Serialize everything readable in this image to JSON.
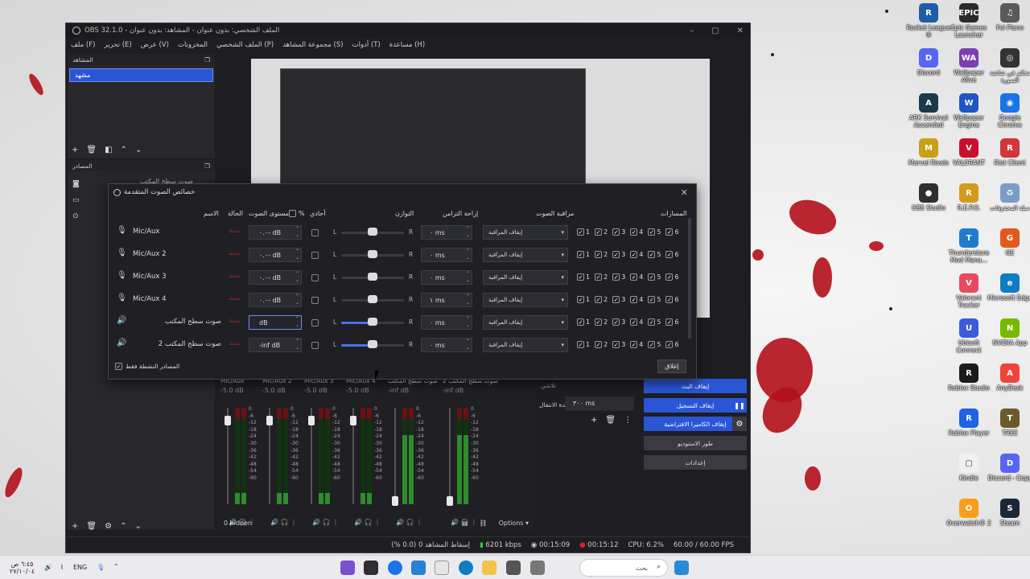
{
  "desktop": {
    "icons": [
      {
        "label": "Rocket League ®",
        "color": "#1e5ea8",
        "glyph": "R"
      },
      {
        "label": "Epic Games Launcher",
        "color": "#2a2a2a",
        "glyph": "EPIC"
      },
      {
        "label": "Foi Plano",
        "color": "#5a5a5a",
        "glyph": "♫"
      },
      {
        "label": "Discord",
        "color": "#5865f2",
        "glyph": "D"
      },
      {
        "label": "Wallpaper Alive",
        "color": "#7a3fb0",
        "glyph": "WA"
      },
      {
        "label": "تحكم في شاشة الصورة",
        "color": "#333",
        "glyph": "◎"
      },
      {
        "label": "ARK Survival Ascended",
        "color": "#1c3a4a",
        "glyph": "A"
      },
      {
        "label": "Wallpaper Engine",
        "color": "#2155c4",
        "glyph": "W"
      },
      {
        "label": "Google Chrome",
        "color": "#1a73e8",
        "glyph": "◉"
      },
      {
        "label": "Marvel Rivals",
        "color": "#c9a016",
        "glyph": "M"
      },
      {
        "label": "VALORANT",
        "color": "#c8102e",
        "glyph": "V"
      },
      {
        "label": "Riot Client",
        "color": "#d13639",
        "glyph": "R"
      },
      {
        "label": "OBS Studio",
        "color": "#302e31",
        "glyph": "●"
      },
      {
        "label": "R.E.P.O.",
        "color": "#d49a1a",
        "glyph": "R"
      },
      {
        "label": "سلة المحذوفات",
        "color": "#7a9cc6",
        "glyph": "♻"
      },
      {
        "label": "Thunderstore Mod Mana...",
        "color": "#1e7ccb",
        "glyph": "T"
      },
      {
        "label": "GE",
        "color": "#e05a1c",
        "glyph": "G"
      },
      {
        "label": "Valorant Tracker",
        "color": "#e84a5f",
        "glyph": "V"
      },
      {
        "label": "Microsoft Edge",
        "color": "#0f7cc4",
        "glyph": "e"
      },
      {
        "label": "Ubisoft Connect",
        "color": "#3b5bdb",
        "glyph": "U"
      },
      {
        "label": "NVIDIA App",
        "color": "#76b900",
        "glyph": "N"
      },
      {
        "label": "Roblox Studio",
        "color": "#1b1b1b",
        "glyph": "R"
      },
      {
        "label": "AnyDesk",
        "color": "#ef443b",
        "glyph": "A"
      },
      {
        "label": "Roblox Player",
        "color": "#1e63e0",
        "glyph": "R"
      },
      {
        "label": "TREE",
        "color": "#6d5a2a",
        "glyph": "T"
      },
      {
        "label": "Kindle",
        "color": "#f0f0f0",
        "glyph": "▢"
      },
      {
        "label": "Discord - Copy",
        "color": "#5865f2",
        "glyph": "D"
      },
      {
        "label": "Overwatch® 2",
        "color": "#f99e1a",
        "glyph": "O"
      },
      {
        "label": "Steam",
        "color": "#1b2838",
        "glyph": "S"
      }
    ]
  },
  "obs": {
    "title": "OBS 32.1.0 - الملف الشخصي: بدون عنوان - المشاهد: بدون عنوان",
    "menu": [
      "ملف (F)",
      "تحرير (E)",
      "عرض (V)",
      "المخزونات",
      "الملف الشخصي (P)",
      "مجموعة المشاهد (S)",
      "أدوات (T)",
      "مساعدة (H)"
    ],
    "scenes_title": "المشاهد",
    "scene_item": "مشهد",
    "sources_title": "المصادر",
    "source_item": "صوت سطح المكتب",
    "hidden_label": "0 hidden",
    "options_label": "Options",
    "transition_label": "مدة الانتقال",
    "transition_value": "٣٠٠ ms",
    "transition_name": "تلاشي",
    "controls": {
      "stop_stream": "إيقاف البث",
      "stop_recording": "إيقاف التسجيل",
      "stop_vcam": "إيقاف الكاميرا الافتراضية",
      "studio_mode": "طور الاستوديو",
      "settings": "إعدادات"
    },
    "mixer": [
      {
        "name": "Mic/Aux",
        "db": "-5.0 dB",
        "level": 0.12
      },
      {
        "name": "Mic/Aux 2",
        "db": "-5.0 dB",
        "level": 0.12
      },
      {
        "name": "Mic/Aux 3",
        "db": "-5.0 dB",
        "level": 0.12
      },
      {
        "name": "Mic/Aux 4",
        "db": "-5.0 dB",
        "level": 0.12
      },
      {
        "name": "صوت سطح المكتب",
        "db": "-inf dB",
        "level": 0.72
      },
      {
        "name": "صوت سطح المكتب 2",
        "db": "-inf dB",
        "level": 0.72
      }
    ],
    "meter_scale": [
      "0",
      "-6",
      "-12",
      "-18",
      "-24",
      "-30",
      "-36",
      "-42",
      "-48",
      "-54",
      "-60"
    ],
    "status": {
      "dropped": "إسقاط المشاهد 0 (0.0 %)",
      "bitrate": "6201 kbps",
      "stream_time": "00:15:09",
      "rec_time": "00:15:12",
      "cpu": "CPU: 6.2%",
      "fps": "60.00 / 60.00 FPS"
    }
  },
  "dialog": {
    "title": "خصائص الصوت المتقدمة",
    "headers": {
      "name": "الاسم",
      "status": "الحالة",
      "volume": "مستوى الصوت",
      "percent": "%",
      "mono": "أحادي",
      "balance": "التوازن",
      "sync": "إزاحة التزامن",
      "monitoring": "مراقبة الصوت",
      "tracks": "المسارات"
    },
    "rows": [
      {
        "name": "Mic/Aux",
        "status": "نشط",
        "volume": "٠.٠- dB",
        "sync": "٠ ms",
        "monitoring": "إيقاف المراقبة",
        "balance": 0.5,
        "rtl": false
      },
      {
        "name": "Mic/Aux 2",
        "status": "نشط",
        "volume": "٠.٠- dB",
        "sync": "٠ ms",
        "monitoring": "إيقاف المراقبة",
        "balance": 0.5,
        "rtl": false
      },
      {
        "name": "Mic/Aux 3",
        "status": "نشط",
        "volume": "٠.٠- dB",
        "sync": "٠ ms",
        "monitoring": "إيقاف المراقبة",
        "balance": 0.5,
        "rtl": false
      },
      {
        "name": "Mic/Aux 4",
        "status": "نشط",
        "volume": "٠.٠- dB",
        "sync": "١ ms",
        "monitoring": "إيقاف المراقبة",
        "balance": 0.5,
        "rtl": false
      },
      {
        "name": "صوت سطح المكتب",
        "status": "نشط",
        "volume": "dB",
        "sync": "٠ ms",
        "monitoring": "إيقاف المراقبة",
        "balance": 0.5,
        "rtl": true
      },
      {
        "name": "صوت سطح المكتب 2",
        "status": "نشط",
        "volume": "-inf dB",
        "sync": "٠ ms",
        "monitoring": "إيقاف المراقبة",
        "balance": 0.5,
        "rtl": true
      }
    ],
    "tracks": [
      "1",
      "2",
      "3",
      "4",
      "5",
      "6"
    ],
    "active_only_label": "المصادر النشطة فقط",
    "close_label": "إغلاق"
  },
  "taskbar": {
    "lang": "ENG",
    "time": "٦:٤٥ ص",
    "date": "٢٧/١٠/٠٤",
    "search": "بحث"
  }
}
